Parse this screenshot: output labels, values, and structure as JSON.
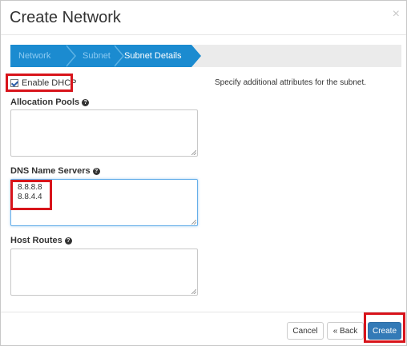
{
  "dialog": {
    "title": "Create Network",
    "close_symbol": "×"
  },
  "wizard": {
    "steps": [
      {
        "label": "Network",
        "active": false
      },
      {
        "label": "Subnet",
        "active": false
      },
      {
        "label": "Subnet Details",
        "active": true
      }
    ]
  },
  "form": {
    "enable_dhcp": {
      "label": "Enable DHCP",
      "checked": true
    },
    "allocation_pools": {
      "label": "Allocation Pools",
      "value": ""
    },
    "dns_name_servers": {
      "label": "DNS Name Servers",
      "lines": [
        "8.8.8.8",
        "8.8.4.4"
      ]
    },
    "host_routes": {
      "label": "Host Routes",
      "value": ""
    },
    "help_icon": "question-circle-icon"
  },
  "description": "Specify additional attributes for the subnet.",
  "footer": {
    "cancel_label": "Cancel",
    "back_label": "« Back",
    "create_label": "Create"
  },
  "colors": {
    "wizard_blue": "#1b8bd0",
    "primary_button": "#337ab7",
    "highlight_red": "#d8141b"
  }
}
